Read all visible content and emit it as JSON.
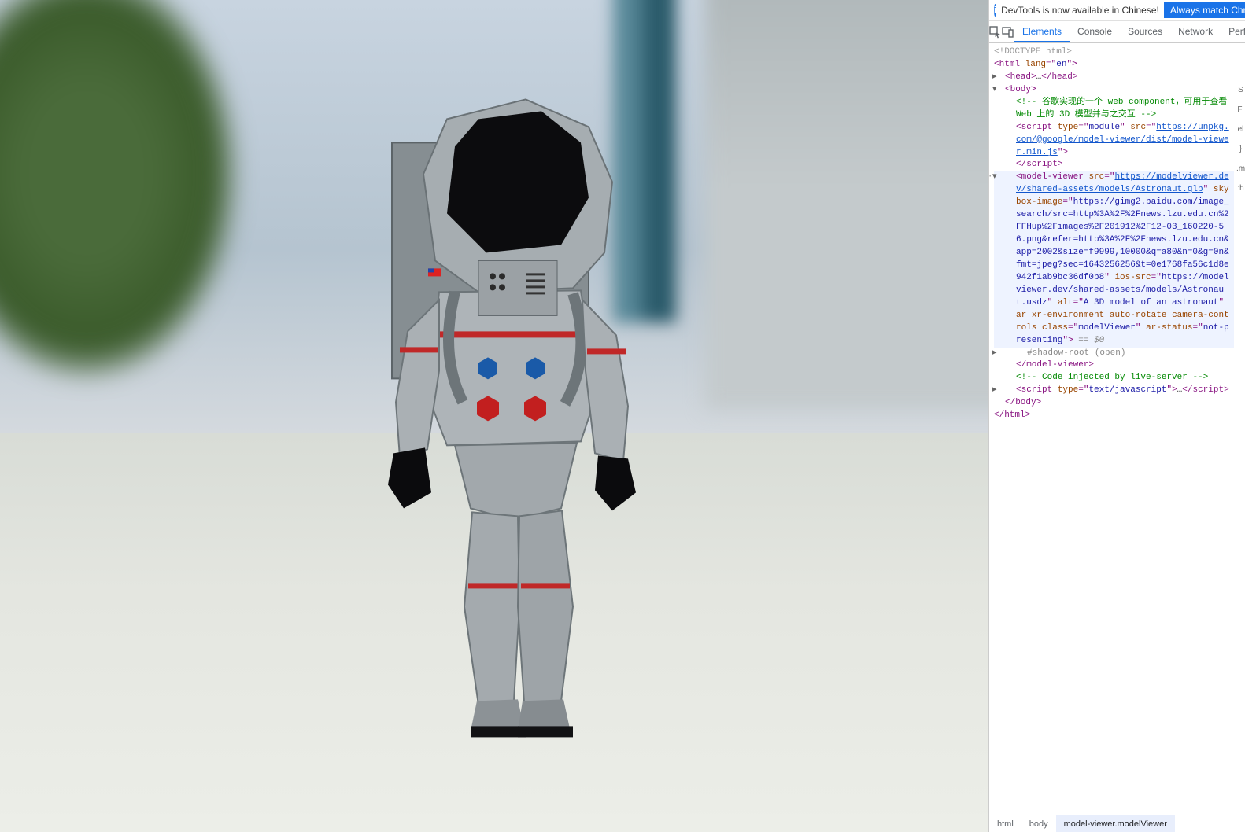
{
  "info_bar": {
    "text": "DevTools is now available in Chinese!",
    "button": "Always match Chrome's lang"
  },
  "tabs": {
    "elements": "Elements",
    "console": "Console",
    "sources": "Sources",
    "network": "Network",
    "performance": "Perform"
  },
  "sidebar_letters": {
    "s": "S",
    "fi": "Fi",
    "el": "el",
    "brace": "}",
    "m": ".m",
    "h": ":h"
  },
  "dom": {
    "doctype": "<!DOCTYPE html>",
    "html_open": "html",
    "html_lang_attr": "lang",
    "html_lang_val": "en",
    "head_open": "head",
    "head_ellipsis": "…",
    "head_close": "head",
    "body_open": "body",
    "comment1": "!-- 谷歌实现的一个 web component，可用于查看 Web 上的 3D 模型并与之交互 --",
    "script1_tag": "script",
    "script1_type_attr": "type",
    "script1_type_val": "module",
    "script1_src_attr": "src",
    "script1_src_val": "https://unpkg.com/@google/model-viewer/dist/model-viewer.min.js",
    "script1_close": "script",
    "mv_tag": "model-viewer",
    "mv_src_attr": "src",
    "mv_src_val": "https://modelviewer.dev/shared-assets/models/Astronaut.glb",
    "mv_skybox_attr": "skybox-image",
    "mv_skybox_val": "https://gimg2.baidu.com/image_search/src=http%3A%2F%2Fnews.lzu.edu.cn%2FFHup%2Fimages%2F201912%2F12-03_160220-56.png&refer=http%3A%2F%2Fnews.lzu.edu.cn&app=2002&size=f9999,10000&q=a80&n=0&g=0n&fmt=jpeg?sec=1643256256&t=0e1768fa56c1d8e942f1ab9bc36df0b8",
    "mv_ios_attr": "ios-src",
    "mv_ios_val": "https://modelviewer.dev/shared-assets/models/Astronaut.usdz",
    "mv_alt_attr": "alt",
    "mv_alt_val": "A 3D model of an astronaut",
    "mv_ar": "ar",
    "mv_xr": "xr-environment",
    "mv_autorotate": "auto-rotate",
    "mv_camera": "camera-controls",
    "mv_class_attr": "class",
    "mv_class_val": "modelViewer",
    "mv_arstatus_attr": "ar-status",
    "mv_arstatus_val": "not-presenting",
    "eq_dollar": " == $0",
    "shadow_root": "#shadow-root (open)",
    "mv_close": "model-viewer",
    "comment2": "!-- Code injected by live-server --",
    "script2_tag": "script",
    "script2_type_attr": "type",
    "script2_type_val": "text/javascript",
    "script2_ellipsis": "…",
    "script2_close": "script",
    "body_close": "body",
    "html_close": "html"
  },
  "breadcrumb": {
    "c1": "html",
    "c2": "body",
    "c3": "model-viewer.modelViewer"
  }
}
